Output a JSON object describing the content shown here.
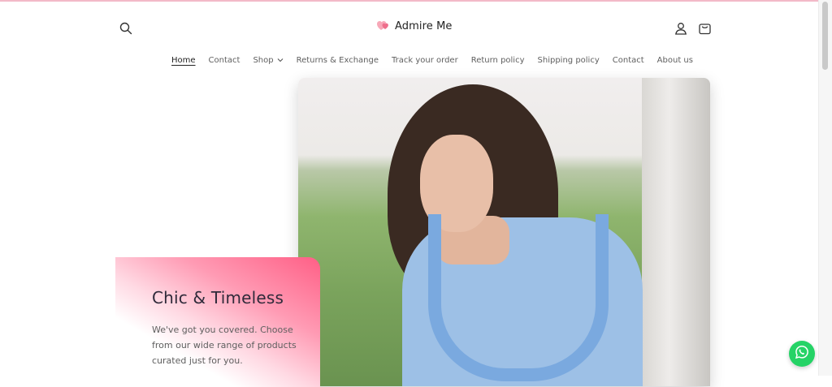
{
  "brand": {
    "name": "Admire Me",
    "logo_icon": "hearts-icon",
    "accent_color": "#f0788f"
  },
  "header": {
    "icons": [
      "search-icon",
      "account-icon",
      "cart-icon"
    ]
  },
  "nav": {
    "items": [
      {
        "label": "Home",
        "active": true
      },
      {
        "label": "Contact"
      },
      {
        "label": "Shop",
        "has_dropdown": true
      },
      {
        "label": "Returns & Exchange"
      },
      {
        "label": "Track your order"
      },
      {
        "label": "Return policy"
      },
      {
        "label": "Shipping policy"
      },
      {
        "label": "Contact"
      },
      {
        "label": "About us"
      }
    ]
  },
  "hero": {
    "title": "Chic & Timeless",
    "text": "We've got you covered. Choose from our wide range of products curated just for you."
  },
  "chat": {
    "icon": "whatsapp-icon",
    "color": "#25d366"
  }
}
